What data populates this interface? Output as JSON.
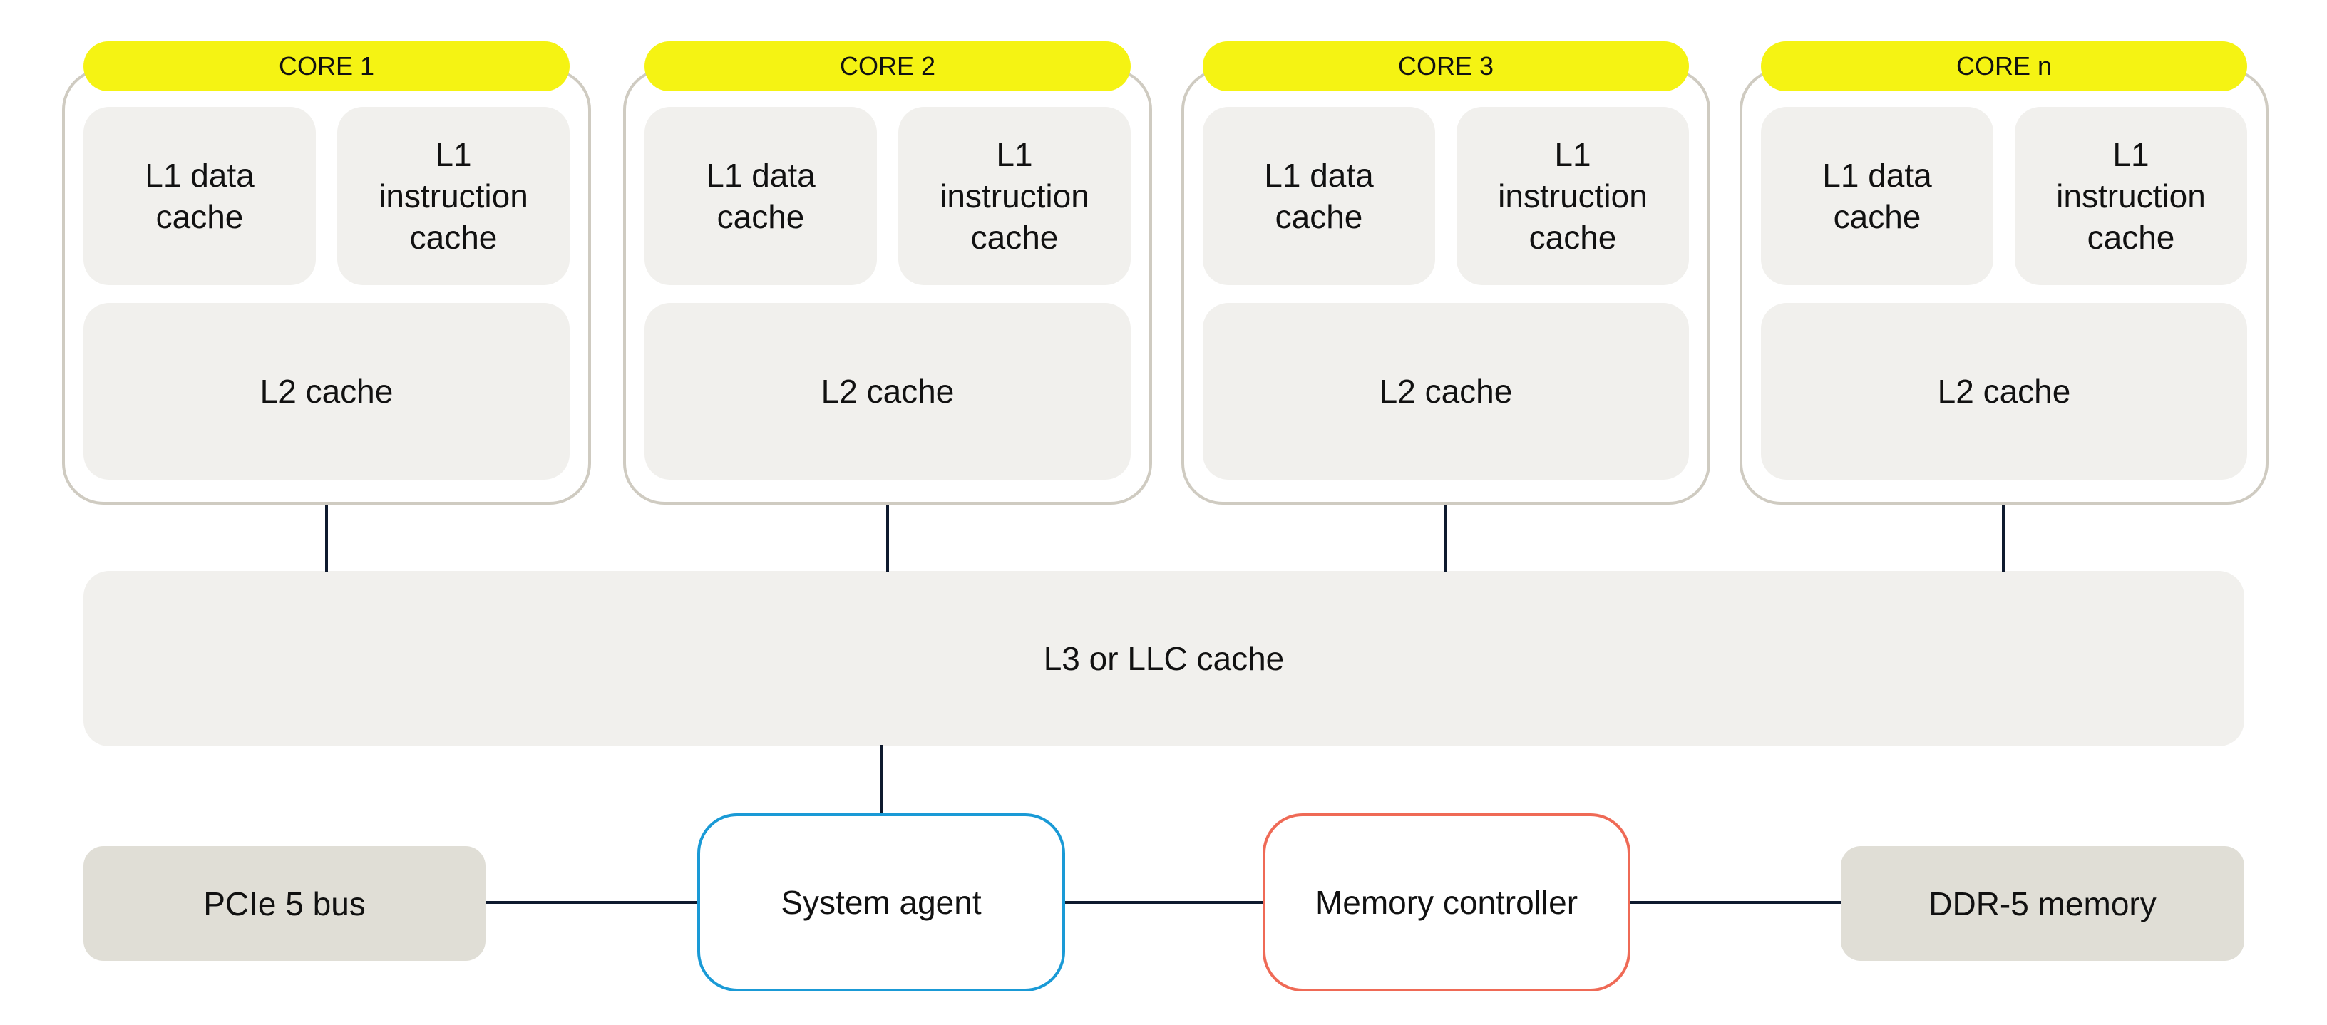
{
  "cores": [
    {
      "label": "CORE 1",
      "l1d": "L1 data cache",
      "l1i": "L1 instruction cache",
      "l2": "L2 cache"
    },
    {
      "label": "CORE 2",
      "l1d": "L1 data cache",
      "l1i": "L1 instruction cache",
      "l2": "L2 cache"
    },
    {
      "label": "CORE 3",
      "l1d": "L1 data cache",
      "l1i": "L1 instruction cache",
      "l2": "L2 cache"
    },
    {
      "label": "CORE n",
      "l1d": "L1 data cache",
      "l1i": "L1 instruction cache",
      "l2": "L2 cache"
    }
  ],
  "l3": "L3 or LLC cache",
  "bottom": {
    "pcie": "PCIe 5 bus",
    "system_agent": "System agent",
    "memory_controller": "Memory controller",
    "ddr": "DDR-5 memory"
  },
  "colors": {
    "core_tab": "#f5f313",
    "system_agent_border": "#1a9ad6",
    "memory_controller_border": "#ef6a56"
  }
}
